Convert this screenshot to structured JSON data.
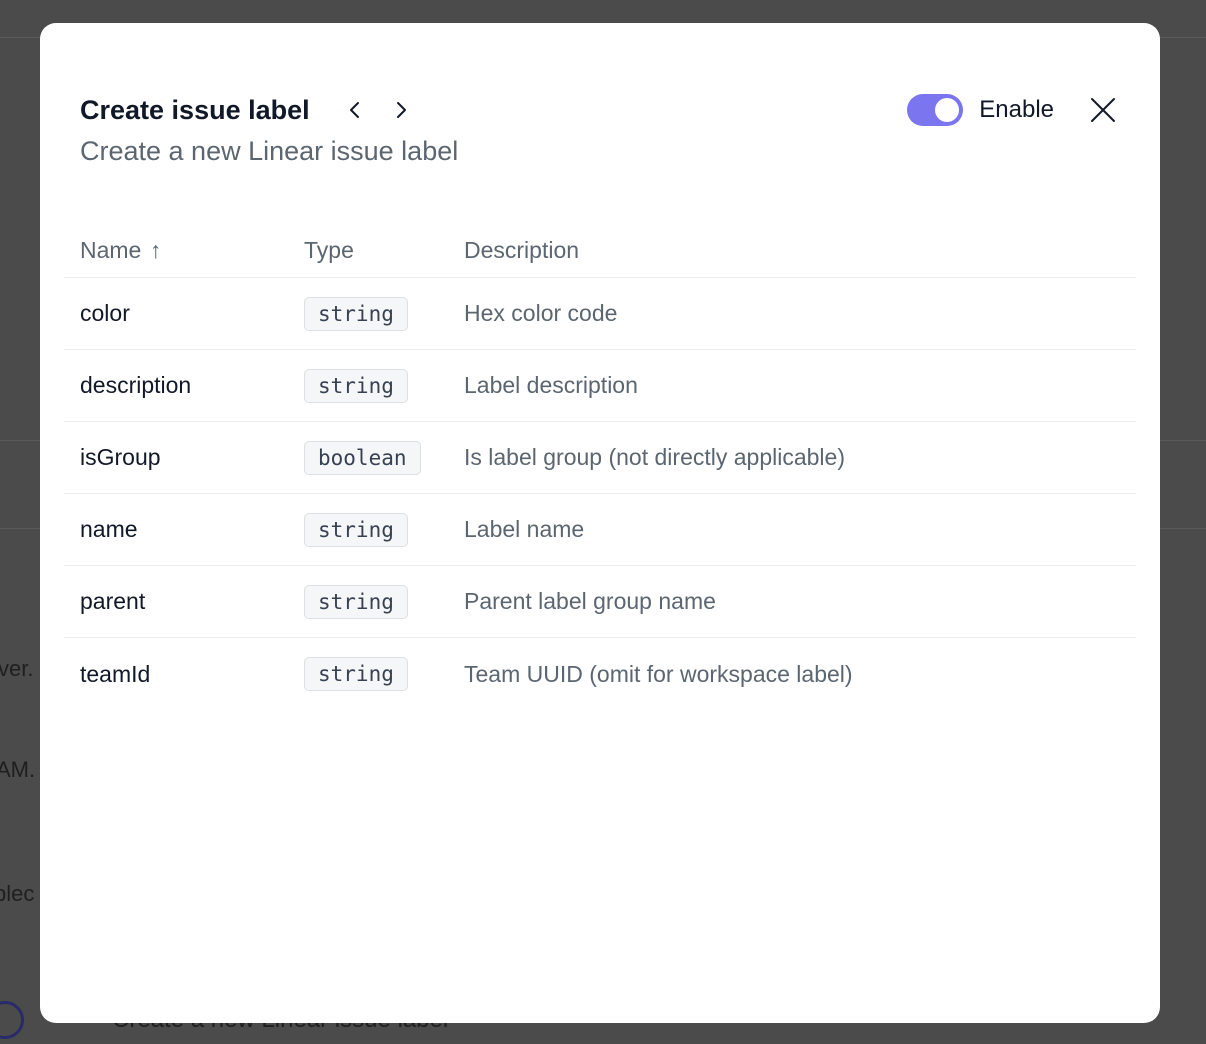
{
  "background": {
    "fragments": [
      "ver.",
      "AM.",
      "blec"
    ],
    "bottom_text": "Create a new Linear issue label"
  },
  "modal": {
    "title": "Create issue label",
    "subtitle": "Create a new Linear issue label",
    "toggle": {
      "label": "Enable",
      "on": true,
      "color": "#7b75f0"
    },
    "icons": {
      "prev": "chevron-left-icon",
      "next": "chevron-right-icon",
      "close": "close-icon",
      "sort": "arrow-up-icon"
    }
  },
  "table": {
    "headers": {
      "name": "Name",
      "type": "Type",
      "description": "Description"
    },
    "sort_indicator": "↑",
    "rows": [
      {
        "name": "color",
        "type": "string",
        "description": "Hex color code"
      },
      {
        "name": "description",
        "type": "string",
        "description": "Label description"
      },
      {
        "name": "isGroup",
        "type": "boolean",
        "description": "Is label group (not directly applicable)"
      },
      {
        "name": "name",
        "type": "string",
        "description": "Label name"
      },
      {
        "name": "parent",
        "type": "string",
        "description": "Parent label group name"
      },
      {
        "name": "teamId",
        "type": "string",
        "description": "Team UUID (omit for workspace label)"
      }
    ]
  }
}
